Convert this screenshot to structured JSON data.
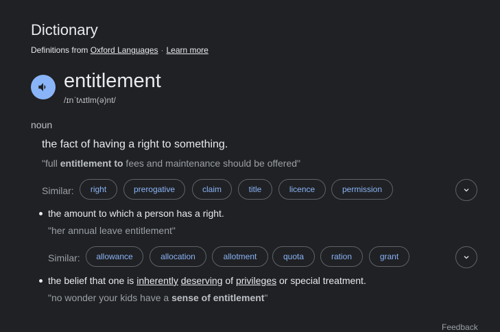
{
  "header": {
    "title": "Dictionary",
    "source_prefix": "Definitions from",
    "source_link": "Oxford Languages",
    "separator": "·",
    "learn_more": "Learn more"
  },
  "entry": {
    "word": "entitlement",
    "phonetic": "/ɪnˈtʌɪtlm(ə)nt/",
    "part_of_speech": "noun"
  },
  "sense1": {
    "definition": "the fact of having a right to something.",
    "example_open": "\"full ",
    "example_bold": "entitlement to",
    "example_rest": " fees and maintenance should be offered\"",
    "similar_label": "Similar:",
    "similar": [
      "right",
      "prerogative",
      "claim",
      "title",
      "licence",
      "permission"
    ]
  },
  "sense2": {
    "definition": "the amount to which a person has a right.",
    "example": "\"her annual leave entitlement\"",
    "similar_label": "Similar:",
    "similar": [
      "allowance",
      "allocation",
      "allotment",
      "quota",
      "ration",
      "grant"
    ]
  },
  "sense3": {
    "def_part1": "the belief that one is ",
    "link1": "inherently",
    "space": " ",
    "link2": "deserving",
    "def_part2": " of ",
    "link3": "privileges",
    "def_part3": " or special treatment.",
    "example_open": "\"no wonder your kids have a ",
    "example_bold": "sense of entitlement",
    "example_close": "\""
  },
  "footer": {
    "feedback": "Feedback"
  },
  "colors": {
    "background": "#202124",
    "accent": "#8ab4f8",
    "chip_border": "#5f6368",
    "muted": "#9aa0a6"
  },
  "icons": {
    "speaker": "volume-icon",
    "expand": "chevron-down-icon"
  }
}
